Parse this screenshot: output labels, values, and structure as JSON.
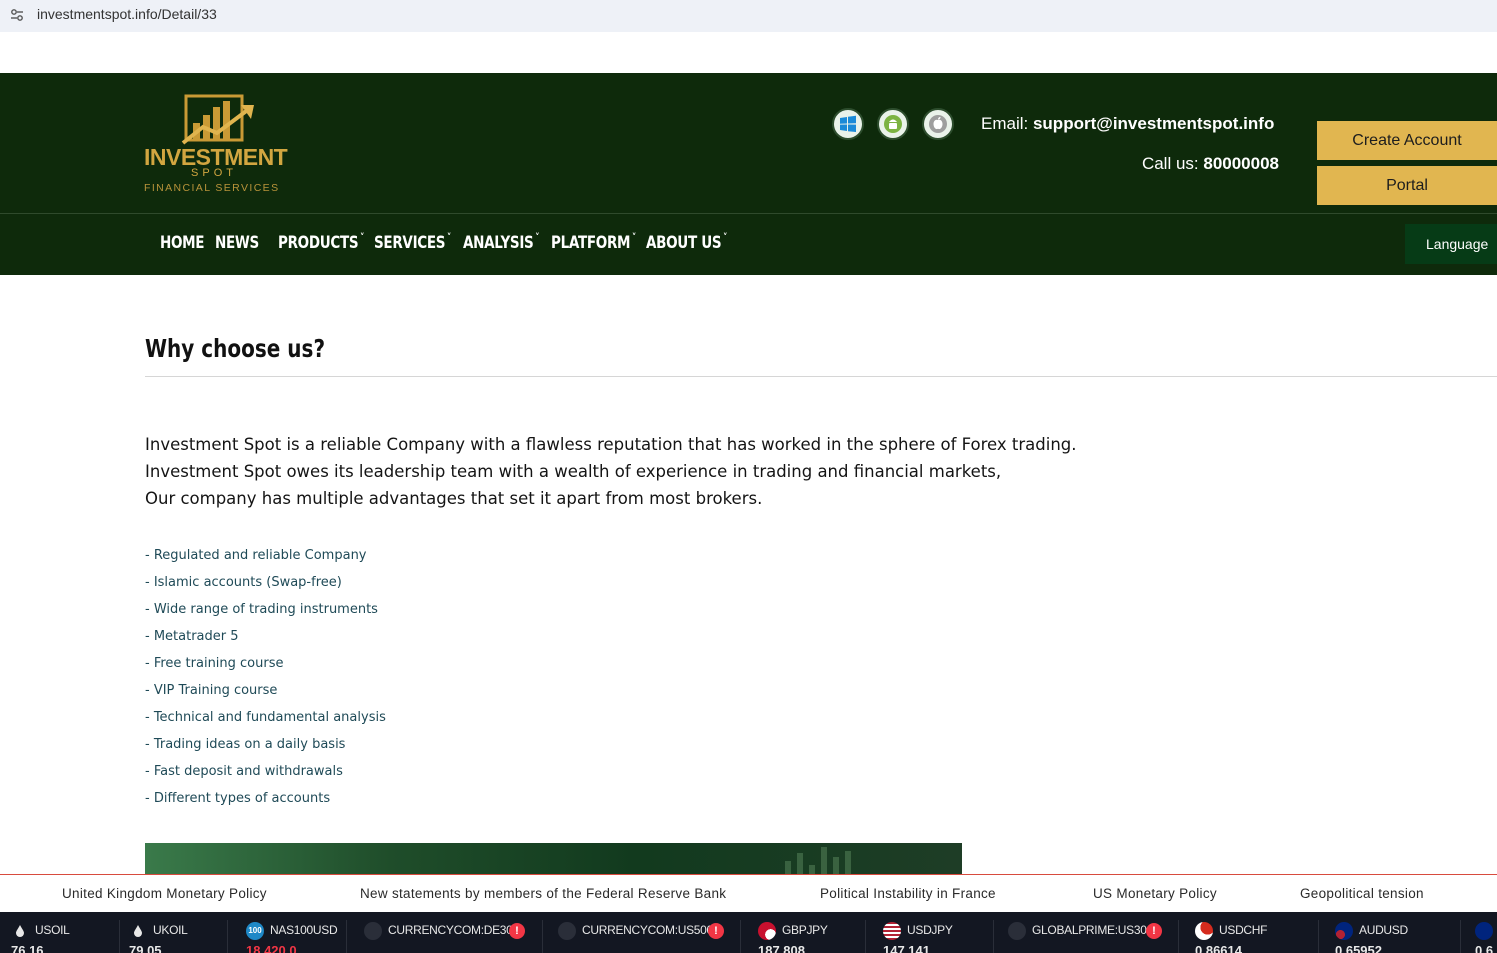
{
  "browser": {
    "url": "investmentspot.info/Detail/33"
  },
  "header": {
    "logo": {
      "brand": "INVESTMENT",
      "sub": "SPOT",
      "tagline": "FINANCIAL SERVICES"
    },
    "platform_icons": [
      "windows-icon",
      "android-icon",
      "apple-icon"
    ],
    "email_label": "Email:",
    "email_value": "support@investmentspot.info",
    "call_label": "Call us:",
    "call_value": "80000008",
    "create_account_label": "Create Account",
    "portal_label": "Portal"
  },
  "nav": {
    "items": [
      {
        "label": "HOME"
      },
      {
        "label": "NEWS"
      },
      {
        "label": "PRODUCTS"
      },
      {
        "label": "SERVICES"
      },
      {
        "label": "ANALYSIS"
      },
      {
        "label": "PLATFORM"
      },
      {
        "label": "ABOUT US"
      }
    ],
    "caret": "˅",
    "language_label": "Language"
  },
  "main": {
    "title": "Why choose us?",
    "intro": [
      "Investment Spot is a reliable Company with a flawless reputation that has worked in the sphere of Forex trading.",
      "Investment Spot owes its leadership team with a wealth of experience in trading and financial markets,",
      "Our company has multiple advantages that set it apart from most brokers."
    ],
    "features": [
      "- Regulated and reliable Company",
      "- Islamic accounts (Swap-free)",
      "- Wide range of trading instruments",
      "- Metatrader 5",
      "- Free training course",
      "- VIP Training course",
      "- Technical and fundamental analysis",
      "- Trading ideas on a daily basis",
      "- Fast deposit and withdrawals",
      "- Different types of accounts"
    ]
  },
  "news_ticker": [
    "United Kingdom Monetary Policy",
    "New statements by members of the Federal Reserve Bank",
    "Political Instability in France",
    "US Monetary Policy",
    "Geopolitical tension"
  ],
  "quotes": [
    {
      "symbol": "USOIL",
      "value": "76.16",
      "icon": "oil-drop-icon",
      "icon_color": "#2a2e39",
      "direction": "up",
      "warning": false
    },
    {
      "symbol": "UKOIL",
      "value": "79.05",
      "icon": "oil-drop-icon",
      "icon_color": "#2a2e39",
      "direction": "up",
      "warning": false
    },
    {
      "symbol": "NAS100USD",
      "value": "18,420.0",
      "icon": "nas100-badge-icon",
      "icon_color": "#1e88c7",
      "direction": "down",
      "warning": false
    },
    {
      "symbol": "CURRENCYCOM:DE30",
      "value": "",
      "icon": "blank-circle-icon",
      "icon_color": "#2a2e39",
      "direction": "up",
      "warning": true
    },
    {
      "symbol": "CURRENCYCOM:US500",
      "value": "",
      "icon": "blank-circle-icon",
      "icon_color": "#2a2e39",
      "direction": "up",
      "warning": true
    },
    {
      "symbol": "GBPJPY",
      "value": "187.808",
      "icon": "gbp-jpy-flags-icon",
      "icon_color": "#c8102e",
      "direction": "up",
      "warning": false
    },
    {
      "symbol": "USDJPY",
      "value": "147.141",
      "icon": "usd-jpy-flags-icon",
      "icon_color": "#3c3b6e",
      "direction": "up",
      "warning": false
    },
    {
      "symbol": "GLOBALPRIME:US30",
      "value": "",
      "icon": "blank-circle-icon",
      "icon_color": "#2a2e39",
      "direction": "up",
      "warning": true
    },
    {
      "symbol": "USDCHF",
      "value": "0.86614",
      "icon": "usd-chf-flags-icon",
      "icon_color": "#d52b1e",
      "direction": "up",
      "warning": false
    },
    {
      "symbol": "AUDUSD",
      "value": "0.65952",
      "icon": "aud-usd-flags-icon",
      "icon_color": "#00247d",
      "direction": "up",
      "warning": false
    },
    {
      "symbol": "",
      "value": "0.6",
      "icon": "flag-icon",
      "icon_color": "#00247d",
      "direction": "up",
      "warning": false
    }
  ],
  "colors": {
    "header_bg": "#0e2a0b",
    "gold": "#e1b650",
    "language_bg": "#063b16",
    "ticker_bg": "#131722",
    "negative": "#f23645"
  }
}
